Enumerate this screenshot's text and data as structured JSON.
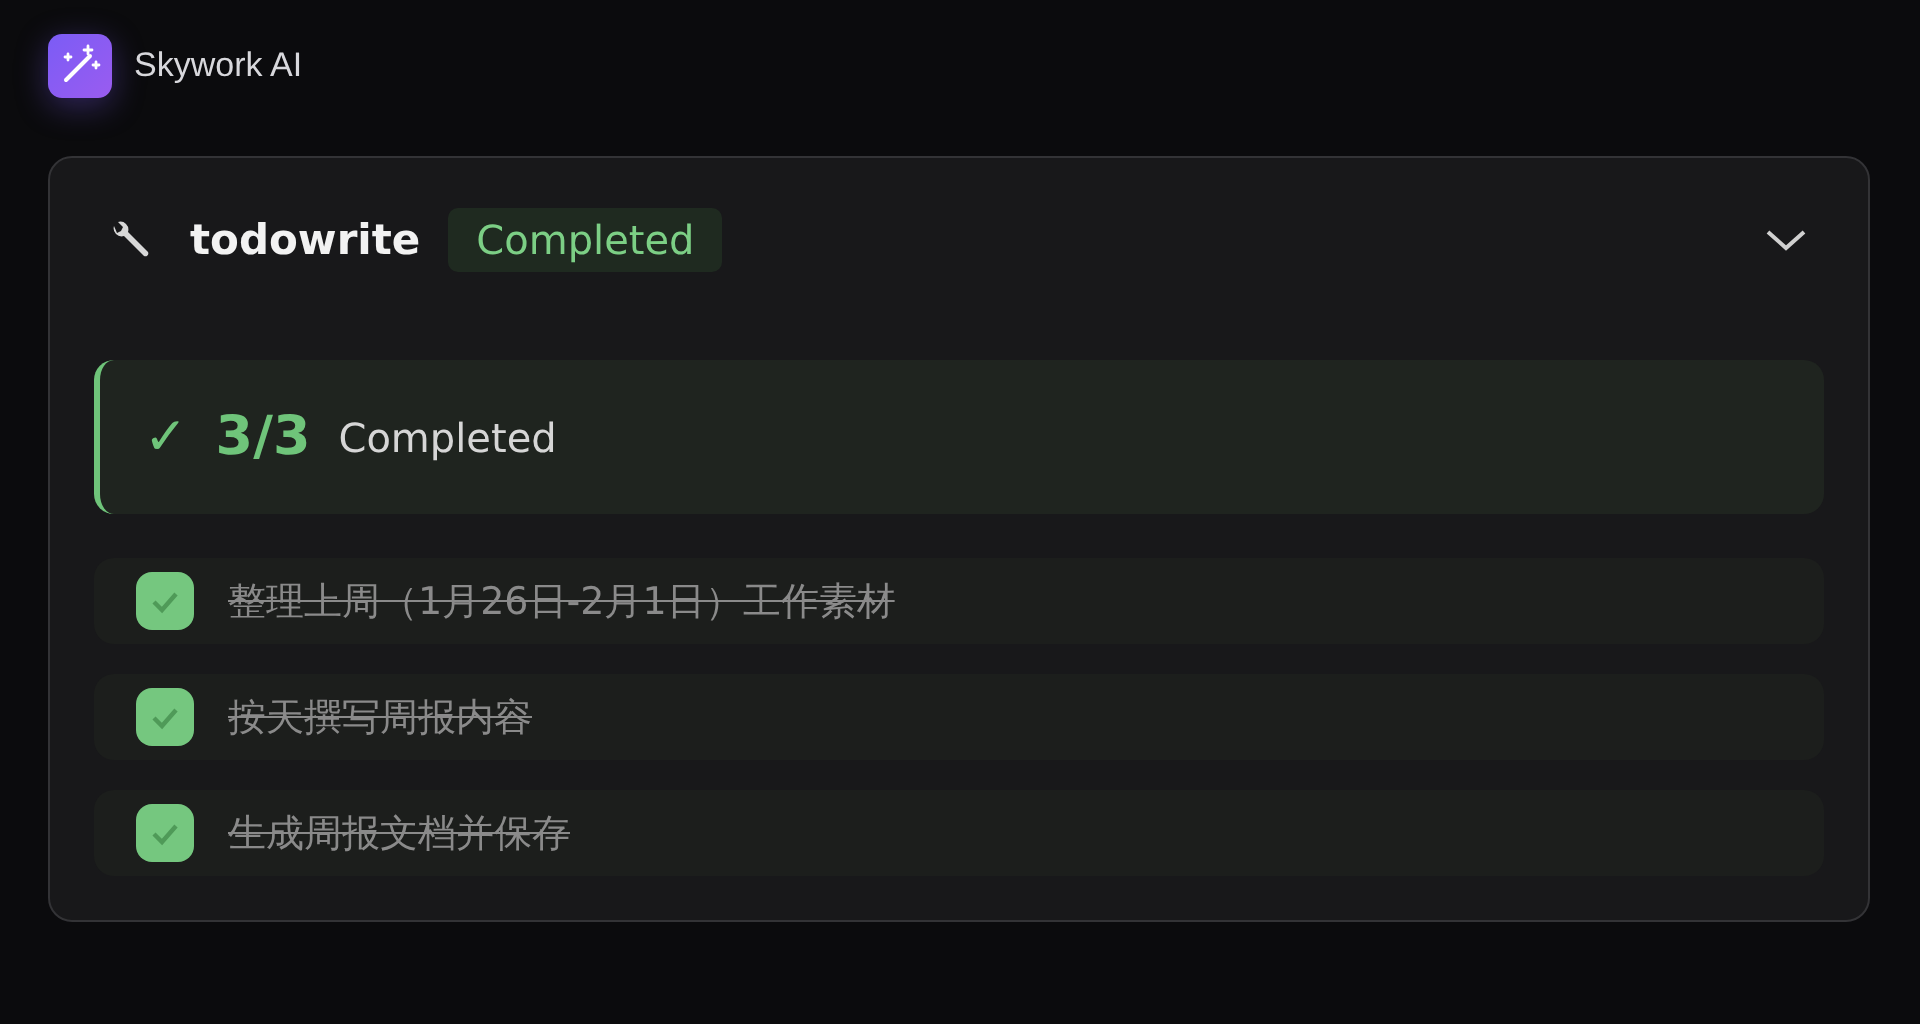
{
  "app": {
    "name": "Skywork AI"
  },
  "tool": {
    "name": "todowrite",
    "status": "Completed",
    "expanded": true
  },
  "summary": {
    "mark": "✓",
    "count": "3/3",
    "label": "Completed"
  },
  "todos": [
    {
      "text": "整理上周（1月26日-2月1日）工作素材",
      "checked": true
    },
    {
      "text": "按天撰写周报内容",
      "checked": true
    },
    {
      "text": "生成周报文档并保存",
      "checked": true
    }
  ]
}
